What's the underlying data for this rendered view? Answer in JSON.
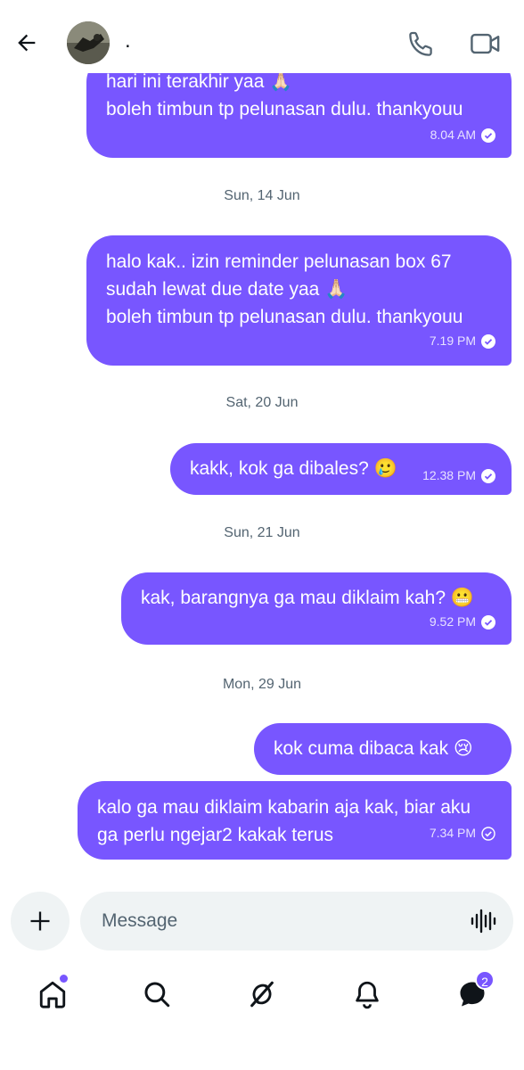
{
  "header": {
    "contact_name": "."
  },
  "messages": [
    {
      "text": "hari ini terakhir yaa 🙏🏻\nboleh timbun tp pelunasan dulu. thankyouu",
      "time": "8.04 AM",
      "status": "read"
    },
    {
      "date": "Sun, 14 Jun"
    },
    {
      "text": "halo kak.. izin reminder pelunasan box 67\nsudah lewat due date yaa 🙏🏻\nboleh timbun tp pelunasan dulu. thankyouu",
      "time": "7.19 PM",
      "status": "read"
    },
    {
      "date": "Sat, 20 Jun"
    },
    {
      "text": "kakk, kok ga dibales? 🥲",
      "time": "12.38 PM",
      "status": "read"
    },
    {
      "date": "Sun, 21 Jun"
    },
    {
      "text": "kak, barangnya ga mau diklaim kah? 😬",
      "time": "9.52 PM",
      "status": "read"
    },
    {
      "date": "Mon, 29 Jun"
    },
    {
      "text": "kok cuma dibaca kak 😢",
      "time": "",
      "status": "read"
    },
    {
      "text": "kalo ga mau diklaim kabarin aja kak, biar aku\nga perlu ngejar2 kakak terus",
      "time": "7.34 PM",
      "status": "sent"
    }
  ],
  "composer": {
    "placeholder": "Message"
  },
  "nav": {
    "items": [
      "home-icon",
      "search-icon",
      "grok-icon",
      "bell-icon",
      "messages-icon"
    ],
    "messages_badge": "2"
  },
  "colors": {
    "accent": "#7856ff",
    "muted": "#536471",
    "input_bg": "#eff3f4"
  }
}
